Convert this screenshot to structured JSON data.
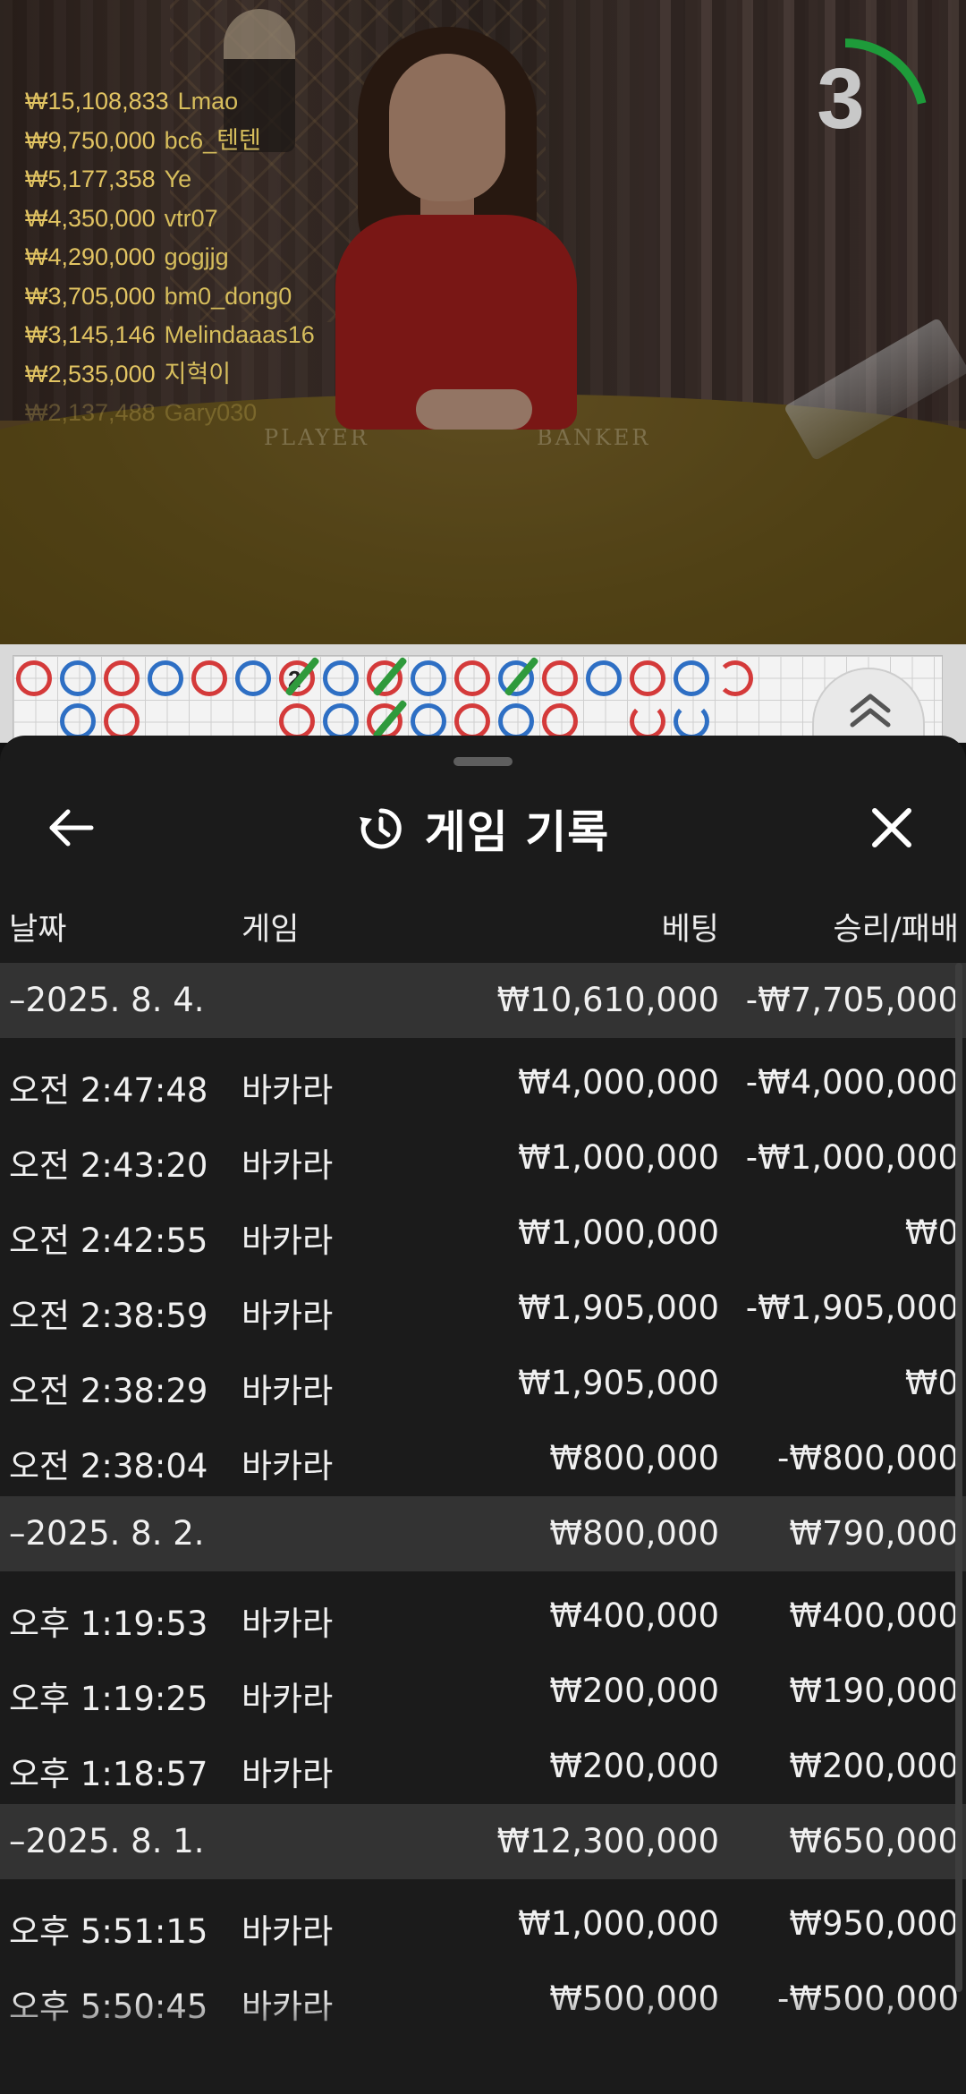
{
  "leaderboard": [
    {
      "amount": "₩15,108,833",
      "name": "Lmao"
    },
    {
      "amount": "₩9,750,000",
      "name": "bc6_텐텐"
    },
    {
      "amount": "₩5,177,358",
      "name": "Ye"
    },
    {
      "amount": "₩4,350,000",
      "name": "vtr07"
    },
    {
      "amount": "₩4,290,000",
      "name": "gogjjg"
    },
    {
      "amount": "₩3,705,000",
      "name": "bm0_dong0"
    },
    {
      "amount": "₩3,145,146",
      "name": "Melindaaas16"
    },
    {
      "amount": "₩2,535,000",
      "name": "지혁이"
    },
    {
      "amount": "₩2,137,488",
      "name": "Gary030"
    }
  ],
  "table_labels": {
    "player": "PLAYER",
    "banker": "BANKER"
  },
  "timer": {
    "value": "3",
    "progress": 0.25,
    "color": "#1e9b3a"
  },
  "roadmap": {
    "number_label": "2"
  },
  "history": {
    "title": "게임 기록",
    "columns": {
      "date": "날짜",
      "game": "게임",
      "bet": "베팅",
      "winloss": "승리/패배"
    },
    "groups": [
      {
        "date": "–2025. 8. 4.",
        "bet": "₩10,610,000",
        "winloss": "-₩7,705,000",
        "items": [
          {
            "time": "오전 2:47:48",
            "game": "바카라",
            "bet": "₩4,000,000",
            "winloss": "-₩4,000,000"
          },
          {
            "time": "오전 2:43:20",
            "game": "바카라",
            "bet": "₩1,000,000",
            "winloss": "-₩1,000,000"
          },
          {
            "time": "오전 2:42:55",
            "game": "바카라",
            "bet": "₩1,000,000",
            "winloss": "₩0"
          },
          {
            "time": "오전 2:38:59",
            "game": "바카라",
            "bet": "₩1,905,000",
            "winloss": "-₩1,905,000"
          },
          {
            "time": "오전 2:38:29",
            "game": "바카라",
            "bet": "₩1,905,000",
            "winloss": "₩0"
          },
          {
            "time": "오전 2:38:04",
            "game": "바카라",
            "bet": "₩800,000",
            "winloss": "-₩800,000"
          }
        ]
      },
      {
        "date": "–2025. 8. 2.",
        "bet": "₩800,000",
        "winloss": "₩790,000",
        "items": [
          {
            "time": "오후 1:19:53",
            "game": "바카라",
            "bet": "₩400,000",
            "winloss": "₩400,000"
          },
          {
            "time": "오후 1:19:25",
            "game": "바카라",
            "bet": "₩200,000",
            "winloss": "₩190,000"
          },
          {
            "time": "오후 1:18:57",
            "game": "바카라",
            "bet": "₩200,000",
            "winloss": "₩200,000"
          }
        ]
      },
      {
        "date": "–2025. 8. 1.",
        "bet": "₩12,300,000",
        "winloss": "₩650,000",
        "items": [
          {
            "time": "오후 5:51:15",
            "game": "바카라",
            "bet": "₩1,000,000",
            "winloss": "₩950,000"
          },
          {
            "time": "오후 5:50:45",
            "game": "바카라",
            "bet": "₩500,000",
            "winloss": "-₩500,000"
          }
        ]
      }
    ]
  },
  "icons": {
    "back": "arrow-left-icon",
    "close": "close-icon",
    "history": "history-icon",
    "expand": "chevron-up-icon"
  }
}
